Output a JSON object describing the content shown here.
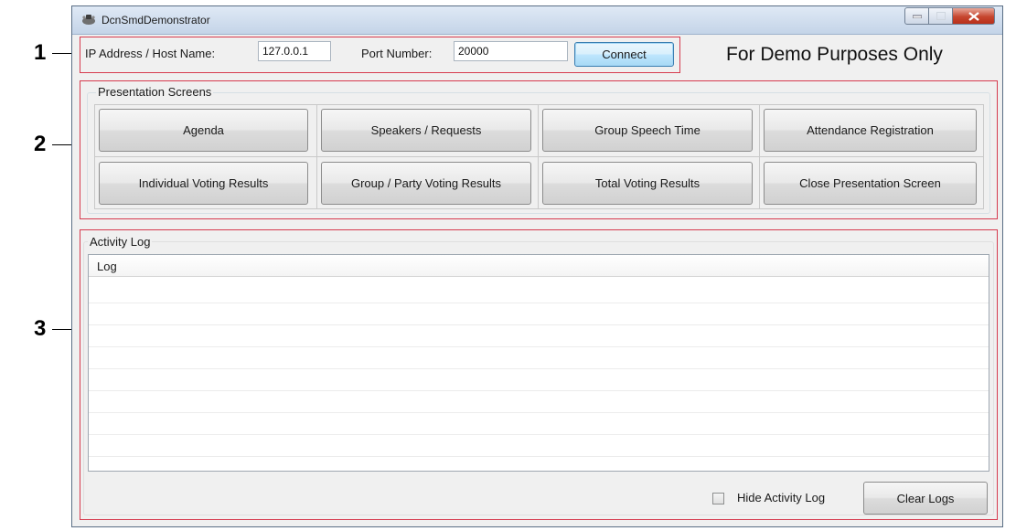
{
  "callouts": [
    "1",
    "2",
    "3"
  ],
  "window": {
    "title": "DcnSmdDemonstrator",
    "controls": [
      "minimize-icon",
      "maximize-icon",
      "close-icon"
    ]
  },
  "connection": {
    "host_label": "IP Address / Host Name:",
    "host_value": "127.0.0.1",
    "port_label": "Port Number:",
    "port_value": "20000",
    "connect_label": "Connect"
  },
  "demo_notice": "For Demo Purposes Only",
  "presentation": {
    "title": "Presentation Screens",
    "buttons": [
      "Agenda",
      "Speakers / Requests",
      "Group Speech Time",
      "Attendance Registration",
      "Individual Voting Results",
      "Group / Party Voting Results",
      "Total Voting Results",
      "Close Presentation Screen"
    ]
  },
  "activity": {
    "title": "Activity Log",
    "column_header": "Log",
    "hide_label": "Hide Activity Log",
    "hide_checked": false,
    "clear_label": "Clear Logs"
  },
  "colors": {
    "callout_box": "#d63a4e",
    "focus_border": "#3c7fb1"
  }
}
